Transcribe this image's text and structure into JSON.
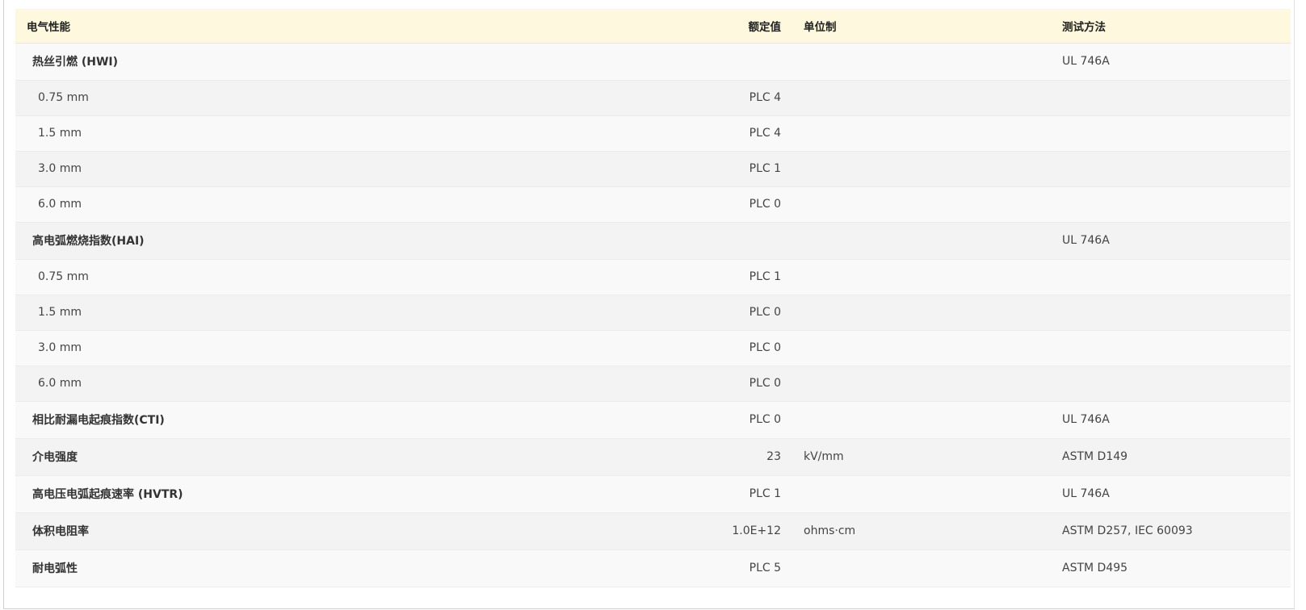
{
  "table": {
    "headers": {
      "property": "电气性能",
      "value": "额定值",
      "unit": "单位制",
      "method": "测试方法"
    },
    "rows": [
      {
        "type": "group",
        "property": "热丝引燃 (HWI)",
        "value": "",
        "unit": "",
        "method": "UL 746A"
      },
      {
        "type": "sub",
        "property": "0.75 mm",
        "value": "PLC 4",
        "unit": "",
        "method": ""
      },
      {
        "type": "sub",
        "property": "1.5 mm",
        "value": "PLC 4",
        "unit": "",
        "method": ""
      },
      {
        "type": "sub",
        "property": "3.0 mm",
        "value": "PLC 1",
        "unit": "",
        "method": ""
      },
      {
        "type": "sub",
        "property": "6.0 mm",
        "value": "PLC 0",
        "unit": "",
        "method": ""
      },
      {
        "type": "group",
        "property": "高电弧燃烧指数(HAI)",
        "value": "",
        "unit": "",
        "method": "UL 746A"
      },
      {
        "type": "sub",
        "property": "0.75 mm",
        "value": "PLC 1",
        "unit": "",
        "method": ""
      },
      {
        "type": "sub",
        "property": "1.5 mm",
        "value": "PLC 0",
        "unit": "",
        "method": ""
      },
      {
        "type": "sub",
        "property": "3.0 mm",
        "value": "PLC 0",
        "unit": "",
        "method": ""
      },
      {
        "type": "sub",
        "property": "6.0 mm",
        "value": "PLC 0",
        "unit": "",
        "method": ""
      },
      {
        "type": "group",
        "property": "相比耐漏电起痕指数(CTI)",
        "value": "PLC 0",
        "unit": "",
        "method": "UL 746A"
      },
      {
        "type": "group",
        "property": "介电强度",
        "value": "23",
        "unit": "kV/mm",
        "method": "ASTM D149"
      },
      {
        "type": "group",
        "property": "高电压电弧起痕速率 (HVTR)",
        "value": "PLC 1",
        "unit": "",
        "method": "UL 746A"
      },
      {
        "type": "group",
        "property": "体积电阻率",
        "value": "1.0E+12",
        "unit": "ohms·cm",
        "method": "ASTM D257, IEC 60093"
      },
      {
        "type": "group",
        "property": "耐电弧性",
        "value": "PLC 5",
        "unit": "",
        "method": "ASTM D495"
      }
    ]
  }
}
